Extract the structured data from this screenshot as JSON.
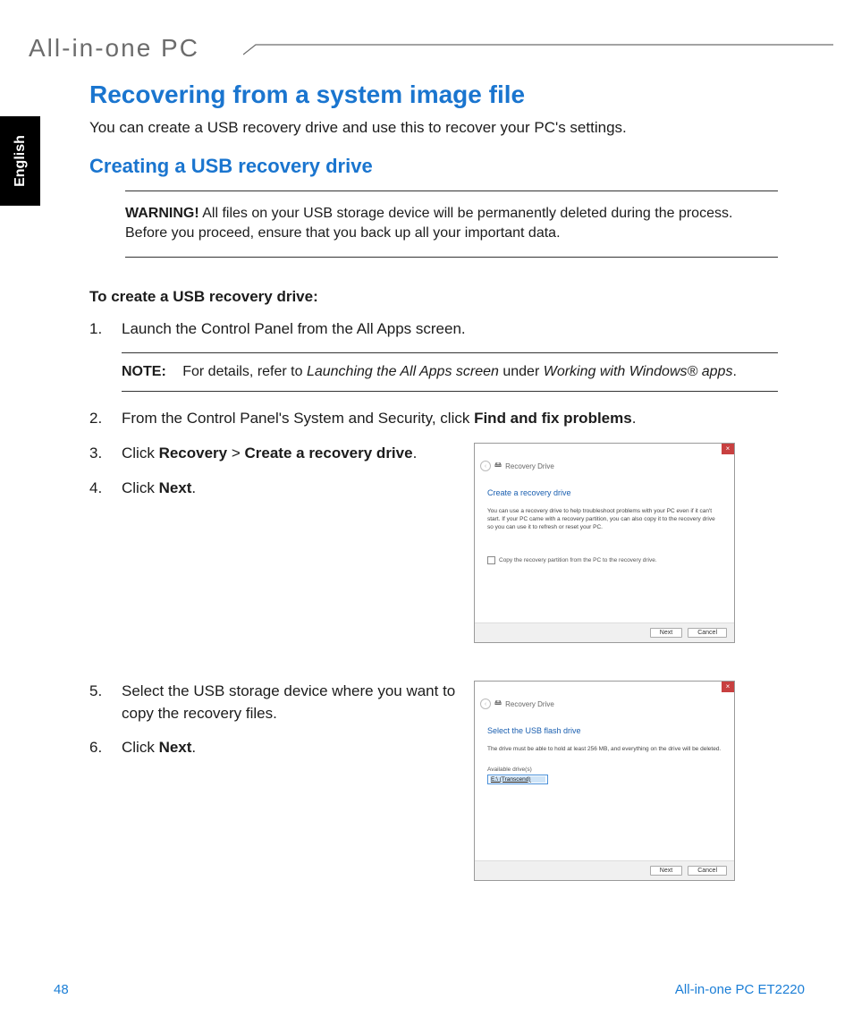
{
  "header": {
    "brand": "All-in-one PC"
  },
  "sidetab": {
    "language": "English"
  },
  "h1": "Recovering from a system image file",
  "intro": "You can create a USB recovery drive and use this to recover your PC's settings.",
  "h2": "Creating a USB recovery drive",
  "warning": {
    "label": "WARNING!",
    "text": "  All files on your USB storage device will be permanently deleted during the process. Before you proceed, ensure that you back up all your important data."
  },
  "subhead": "To create a USB recovery drive:",
  "steps": {
    "s1": {
      "num": "1.",
      "text": "Launch the Control Panel from the All Apps screen."
    },
    "note": {
      "label": "NOTE:",
      "pre": "For details, refer to ",
      "em1": "Launching the All Apps screen",
      "mid": " under ",
      "em2": "Working with Windows® apps",
      "post": "."
    },
    "s2": {
      "num": "2.",
      "pre": "From the Control Panel's System and Security, click ",
      "bold": "Find and fix problems",
      "post": "."
    },
    "s3": {
      "num": "3.",
      "pre": "Click ",
      "b1": "Recovery",
      "mid": " > ",
      "b2": "Create a recovery drive",
      "post": "."
    },
    "s4": {
      "num": "4.",
      "pre": "Click ",
      "b1": "Next",
      "post": "."
    },
    "s5": {
      "num": "5.",
      "text": "Select the USB storage device where you want to copy the recovery files."
    },
    "s6": {
      "num": "6.",
      "pre": "Click ",
      "b1": "Next",
      "post": "."
    }
  },
  "wizard1": {
    "title": "Recovery Drive",
    "heading": "Create a recovery drive",
    "body": "You can use a recovery drive to help troubleshoot problems with your PC even if it can't start. If your PC came with a recovery partition, you can also copy it to the recovery drive so you can use it to refresh or reset your PC.",
    "checkbox": "Copy the recovery partition from the PC to the recovery drive.",
    "next": "Next",
    "cancel": "Cancel"
  },
  "wizard2": {
    "title": "Recovery Drive",
    "heading": "Select the USB flash drive",
    "body": "The drive must be able to hold at least 256 MB, and everything on the drive will be deleted.",
    "list_label": "Available drive(s)",
    "list_item": "E:\\ (Transcend)",
    "next": "Next",
    "cancel": "Cancel"
  },
  "footer": {
    "page": "48",
    "model": "All-in-one PC ET2220"
  }
}
